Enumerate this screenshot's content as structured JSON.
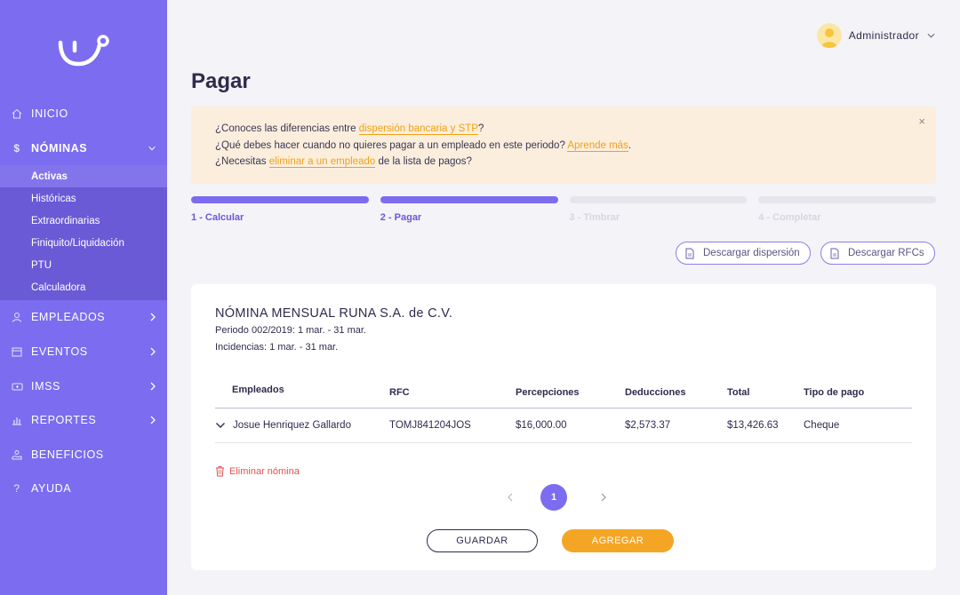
{
  "colors": {
    "sidebar": "#7b6cf0",
    "accent": "#7b6cf0",
    "orange": "#f5a524",
    "danger": "#e2524d",
    "alert_bg": "#fbeedd"
  },
  "sidebar": {
    "items": [
      {
        "label": "INICIO",
        "icon": "home-icon"
      },
      {
        "label": "NÓMINAS",
        "icon": "dollar-icon",
        "expanded": true,
        "children": [
          "Activas",
          "Históricas",
          "Extraordinarias",
          "Finiquito/Liquidación",
          "PTU",
          "Calculadora"
        ],
        "active_child": "Activas"
      },
      {
        "label": "EMPLEADOS",
        "icon": "user-icon"
      },
      {
        "label": "EVENTOS",
        "icon": "calendar-icon"
      },
      {
        "label": "IMSS",
        "icon": "health-card-icon"
      },
      {
        "label": "REPORTES",
        "icon": "bar-chart-icon"
      },
      {
        "label": "BENEFICIOS",
        "icon": "hand-benefit-icon"
      },
      {
        "label": "AYUDA",
        "icon": "question-icon"
      }
    ]
  },
  "header": {
    "user_name": "Administrador"
  },
  "page": {
    "title": "Pagar"
  },
  "alert": {
    "line1_pre": "¿Conoces las diferencias entre ",
    "line1_link": "dispersión bancaria y STP",
    "line1_post": "?",
    "line2_pre": "¿Qué debes hacer cuando no quieres pagar a un empleado en este periodo? ",
    "line2_link": "Aprende más",
    "line2_post": ".",
    "line3_pre": "¿Necesitas ",
    "line3_link": "eliminar a un empleado",
    "line3_post": " de la lista de pagos?",
    "close": "×"
  },
  "steps": [
    {
      "label": "1 - Calcular",
      "done": true
    },
    {
      "label": "2 - Pagar",
      "done": true
    },
    {
      "label": "3 - Timbrar",
      "done": false
    },
    {
      "label": "4 - Completar",
      "done": false
    }
  ],
  "downloads": {
    "dispersion": "Descargar dispersión",
    "rfcs": "Descargar RFCs"
  },
  "card": {
    "title": "NÓMINA MENSUAL RUNA S.A. de C.V.",
    "periodo": "Periodo 002/2019: 1 mar. - 31 mar.",
    "incidencias": "Incidencias: 1 mar. - 31 mar.",
    "table": {
      "headers": [
        "Empleados",
        "RFC",
        "Percepciones",
        "Deducciones",
        "Total",
        "Tipo de pago"
      ],
      "rows": [
        [
          "Josue Henriquez Gallardo",
          "TOMJ841204JOS",
          "$16,000.00",
          "$2,573.37",
          "$13,426.63",
          "Cheque"
        ]
      ]
    },
    "delete_label": "Eliminar nómina",
    "pager": {
      "current": "1"
    },
    "save_label": "GUARDAR",
    "add_label": "AGREGAR"
  }
}
